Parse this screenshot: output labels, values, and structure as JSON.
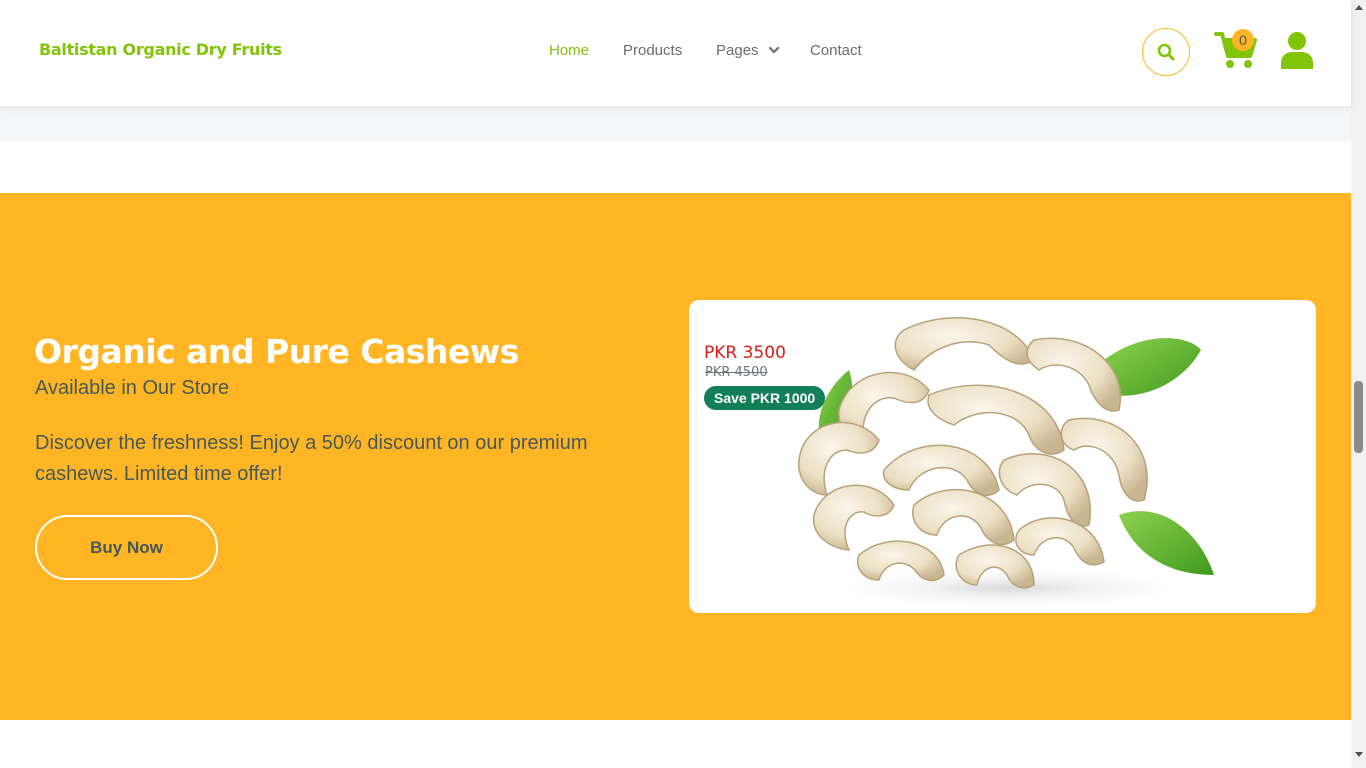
{
  "header": {
    "brand": "Baltistan Organic Dry Fruits",
    "nav": {
      "home": "Home",
      "products": "Products",
      "pages": "Pages",
      "contact": "Contact"
    },
    "cart_count": "0",
    "icons": {
      "search": "search-icon",
      "cart": "shopping-cart-icon",
      "user": "user-icon",
      "dropdown": "chevron-down-icon"
    }
  },
  "banner": {
    "title": "Organic and Pure Cashews",
    "subtitle": "Available in Our Store",
    "description": "Discover the freshness! Enjoy a 50% discount on our premium cashews. Limited time offer!",
    "button": "Buy Now"
  },
  "product": {
    "price_now": "PKR 3500",
    "price_old": "PKR 4500",
    "save": "Save PKR 1000",
    "image": "cashews-with-leaves"
  },
  "colors": {
    "primary": "#81c408",
    "accent": "#ffb524",
    "text": "#45595b",
    "price_red": "#e01a1a",
    "badge_green": "#127f58"
  }
}
